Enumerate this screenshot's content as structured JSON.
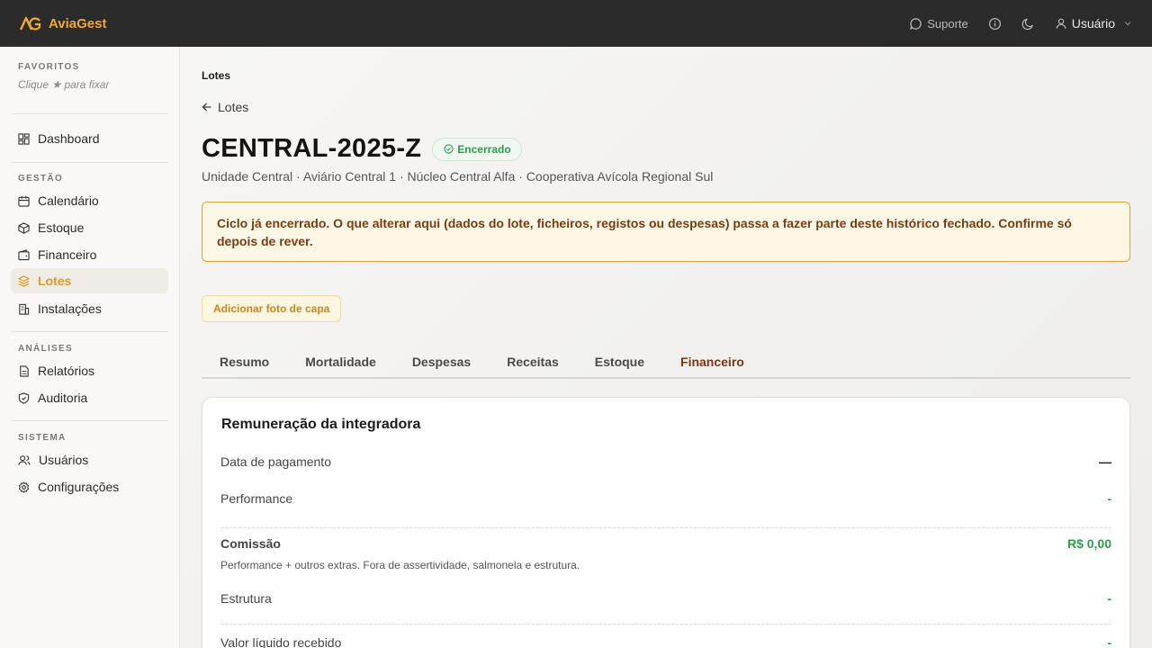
{
  "app": {
    "name": "AviaGest"
  },
  "topbar": {
    "support_label": "Suporte",
    "user_label": "Usuário"
  },
  "sidebar": {
    "favorites_title": "FAVORITOS",
    "favorites_hint": "Clique ★ para fixar",
    "dashboard": "Dashboard",
    "gestao_title": "GESTÃO",
    "calendario": "Calendário",
    "estoque": "Estoque",
    "financeiro": "Financeiro",
    "lotes": "Lotes",
    "instalacoes": "Instalações",
    "analises_title": "ANÁLISES",
    "relatorios": "Relatórios",
    "auditoria": "Auditoria",
    "sistema_title": "SISTEMA",
    "usuarios": "Usuários",
    "configuracoes": "Configurações"
  },
  "page": {
    "breadcrumb": "Lotes",
    "back_label": "Lotes",
    "title": "CENTRAL-2025-Z",
    "status": "Encerrado",
    "subtitle": "Unidade Central · Aviário Central 1 · Núcleo Central Alfa · Cooperativa Avícola Regional Sul",
    "alert": "Ciclo já encerrado. O que alterar aqui (dados do lote, ficheiros, registos ou despesas) passa a fazer parte deste histórico fechado. Confirme só depois de rever.",
    "cover_button": "Adicionar foto de capa"
  },
  "tabs": [
    "Resumo",
    "Mortalidade",
    "Despesas",
    "Receitas",
    "Estoque",
    "Financeiro"
  ],
  "card": {
    "title": "Remuneração da integradora",
    "data_pagamento_label": "Data de pagamento",
    "data_pagamento_value": "—",
    "performance_label": "Performance",
    "performance_value": "-",
    "comissao_label": "Comissão",
    "comissao_value": "R$ 0,00",
    "comissao_note": "Performance + outros extras. Fora de assertividade, salmonela e estrutura.",
    "estrutura_label": "Estrutura",
    "estrutura_value": "-",
    "liquido_label": "Valor líquido recebido",
    "liquido_value": "-"
  },
  "colors": {
    "accent": "#e19a1c",
    "success": "#2f9a4c",
    "alert_text": "#7a3a13",
    "topbar": "#2b2b2b"
  }
}
